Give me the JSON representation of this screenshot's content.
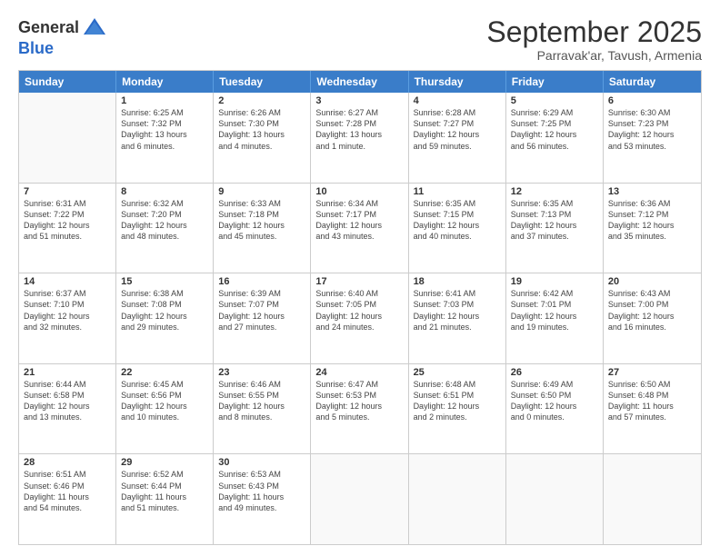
{
  "header": {
    "logo_general": "General",
    "logo_blue": "Blue",
    "title": "September 2025",
    "subtitle": "Parravak'ar, Tavush, Armenia"
  },
  "days": [
    "Sunday",
    "Monday",
    "Tuesday",
    "Wednesday",
    "Thursday",
    "Friday",
    "Saturday"
  ],
  "weeks": [
    [
      {
        "date": "",
        "info": ""
      },
      {
        "date": "1",
        "info": "Sunrise: 6:25 AM\nSunset: 7:32 PM\nDaylight: 13 hours\nand 6 minutes."
      },
      {
        "date": "2",
        "info": "Sunrise: 6:26 AM\nSunset: 7:30 PM\nDaylight: 13 hours\nand 4 minutes."
      },
      {
        "date": "3",
        "info": "Sunrise: 6:27 AM\nSunset: 7:28 PM\nDaylight: 13 hours\nand 1 minute."
      },
      {
        "date": "4",
        "info": "Sunrise: 6:28 AM\nSunset: 7:27 PM\nDaylight: 12 hours\nand 59 minutes."
      },
      {
        "date": "5",
        "info": "Sunrise: 6:29 AM\nSunset: 7:25 PM\nDaylight: 12 hours\nand 56 minutes."
      },
      {
        "date": "6",
        "info": "Sunrise: 6:30 AM\nSunset: 7:23 PM\nDaylight: 12 hours\nand 53 minutes."
      }
    ],
    [
      {
        "date": "7",
        "info": "Sunrise: 6:31 AM\nSunset: 7:22 PM\nDaylight: 12 hours\nand 51 minutes."
      },
      {
        "date": "8",
        "info": "Sunrise: 6:32 AM\nSunset: 7:20 PM\nDaylight: 12 hours\nand 48 minutes."
      },
      {
        "date": "9",
        "info": "Sunrise: 6:33 AM\nSunset: 7:18 PM\nDaylight: 12 hours\nand 45 minutes."
      },
      {
        "date": "10",
        "info": "Sunrise: 6:34 AM\nSunset: 7:17 PM\nDaylight: 12 hours\nand 43 minutes."
      },
      {
        "date": "11",
        "info": "Sunrise: 6:35 AM\nSunset: 7:15 PM\nDaylight: 12 hours\nand 40 minutes."
      },
      {
        "date": "12",
        "info": "Sunrise: 6:35 AM\nSunset: 7:13 PM\nDaylight: 12 hours\nand 37 minutes."
      },
      {
        "date": "13",
        "info": "Sunrise: 6:36 AM\nSunset: 7:12 PM\nDaylight: 12 hours\nand 35 minutes."
      }
    ],
    [
      {
        "date": "14",
        "info": "Sunrise: 6:37 AM\nSunset: 7:10 PM\nDaylight: 12 hours\nand 32 minutes."
      },
      {
        "date": "15",
        "info": "Sunrise: 6:38 AM\nSunset: 7:08 PM\nDaylight: 12 hours\nand 29 minutes."
      },
      {
        "date": "16",
        "info": "Sunrise: 6:39 AM\nSunset: 7:07 PM\nDaylight: 12 hours\nand 27 minutes."
      },
      {
        "date": "17",
        "info": "Sunrise: 6:40 AM\nSunset: 7:05 PM\nDaylight: 12 hours\nand 24 minutes."
      },
      {
        "date": "18",
        "info": "Sunrise: 6:41 AM\nSunset: 7:03 PM\nDaylight: 12 hours\nand 21 minutes."
      },
      {
        "date": "19",
        "info": "Sunrise: 6:42 AM\nSunset: 7:01 PM\nDaylight: 12 hours\nand 19 minutes."
      },
      {
        "date": "20",
        "info": "Sunrise: 6:43 AM\nSunset: 7:00 PM\nDaylight: 12 hours\nand 16 minutes."
      }
    ],
    [
      {
        "date": "21",
        "info": "Sunrise: 6:44 AM\nSunset: 6:58 PM\nDaylight: 12 hours\nand 13 minutes."
      },
      {
        "date": "22",
        "info": "Sunrise: 6:45 AM\nSunset: 6:56 PM\nDaylight: 12 hours\nand 10 minutes."
      },
      {
        "date": "23",
        "info": "Sunrise: 6:46 AM\nSunset: 6:55 PM\nDaylight: 12 hours\nand 8 minutes."
      },
      {
        "date": "24",
        "info": "Sunrise: 6:47 AM\nSunset: 6:53 PM\nDaylight: 12 hours\nand 5 minutes."
      },
      {
        "date": "25",
        "info": "Sunrise: 6:48 AM\nSunset: 6:51 PM\nDaylight: 12 hours\nand 2 minutes."
      },
      {
        "date": "26",
        "info": "Sunrise: 6:49 AM\nSunset: 6:50 PM\nDaylight: 12 hours\nand 0 minutes."
      },
      {
        "date": "27",
        "info": "Sunrise: 6:50 AM\nSunset: 6:48 PM\nDaylight: 11 hours\nand 57 minutes."
      }
    ],
    [
      {
        "date": "28",
        "info": "Sunrise: 6:51 AM\nSunset: 6:46 PM\nDaylight: 11 hours\nand 54 minutes."
      },
      {
        "date": "29",
        "info": "Sunrise: 6:52 AM\nSunset: 6:44 PM\nDaylight: 11 hours\nand 51 minutes."
      },
      {
        "date": "30",
        "info": "Sunrise: 6:53 AM\nSunset: 6:43 PM\nDaylight: 11 hours\nand 49 minutes."
      },
      {
        "date": "",
        "info": ""
      },
      {
        "date": "",
        "info": ""
      },
      {
        "date": "",
        "info": ""
      },
      {
        "date": "",
        "info": ""
      }
    ]
  ]
}
